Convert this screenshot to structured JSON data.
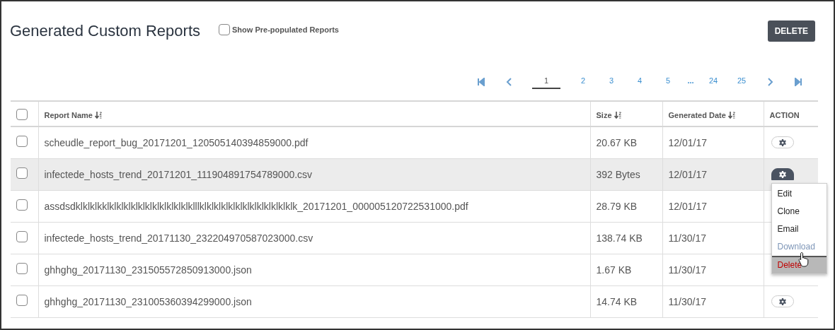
{
  "title": "Generated Custom Reports",
  "show_prepopulated": {
    "label": "Show Pre-populated Reports",
    "checked": false
  },
  "delete_button": "DELETE",
  "pagination": [
    {
      "kind": "first"
    },
    {
      "kind": "prev"
    },
    {
      "kind": "page",
      "label": "1",
      "selected": true
    },
    {
      "kind": "page",
      "label": "2",
      "selected": false
    },
    {
      "kind": "page",
      "label": "3",
      "selected": false
    },
    {
      "kind": "page",
      "label": "4",
      "selected": false
    },
    {
      "kind": "page",
      "label": "5",
      "selected": false
    },
    {
      "kind": "ellipsis",
      "label": "..."
    },
    {
      "kind": "page",
      "label": "24",
      "selected": false
    },
    {
      "kind": "page",
      "label": "25",
      "selected": false
    },
    {
      "kind": "next"
    },
    {
      "kind": "last"
    }
  ],
  "table": {
    "select_all_checked": false,
    "columns": [
      {
        "label": "Report Name",
        "sortable": true
      },
      {
        "label": "Size",
        "sortable": true
      },
      {
        "label": "Generated Date",
        "sortable": true
      },
      {
        "label": "ACTION",
        "sortable": false
      }
    ],
    "rows": [
      {
        "name": "scheudle_report_bug_20171201_120505140394859000.pdf",
        "size": "20.67 KB",
        "date": "12/01/17",
        "checked": false,
        "selected": false,
        "gear": true
      },
      {
        "name": "infectede_hosts_trend_20171201_111904891754789000.csv",
        "size": "392 Bytes",
        "date": "12/01/17",
        "checked": false,
        "selected": true,
        "gear": true
      },
      {
        "name": "assdsdklklklkklklklklklklklklklklklklklllklklklklklklklklklklklklklk_20171201_000005120722531000.pdf",
        "size": "28.79 KB",
        "date": "12/01/17",
        "checked": false,
        "selected": false,
        "gear": false
      },
      {
        "name": "infectede_hosts_trend_20171130_232204970587023000.csv",
        "size": "138.74 KB",
        "date": "11/30/17",
        "checked": false,
        "selected": false,
        "gear": false
      },
      {
        "name": "ghhghg_20171130_231505572850913000.json",
        "size": "1.67 KB",
        "date": "11/30/17",
        "checked": false,
        "selected": false,
        "gear": false
      },
      {
        "name": "ghhghg_20171130_231005360394299000.json",
        "size": "14.74 KB",
        "date": "11/30/17",
        "checked": false,
        "selected": false,
        "gear": true
      }
    ]
  },
  "action_menu": {
    "items": [
      {
        "label": "Edit",
        "disabled": false,
        "danger": false,
        "selected": false
      },
      {
        "label": "Clone",
        "disabled": false,
        "danger": false,
        "selected": false
      },
      {
        "label": "Email",
        "disabled": false,
        "danger": false,
        "selected": false
      },
      {
        "label": "Download",
        "disabled": true,
        "danger": false,
        "selected": false
      },
      {
        "label": "Delete",
        "disabled": false,
        "danger": true,
        "selected": true
      }
    ]
  }
}
